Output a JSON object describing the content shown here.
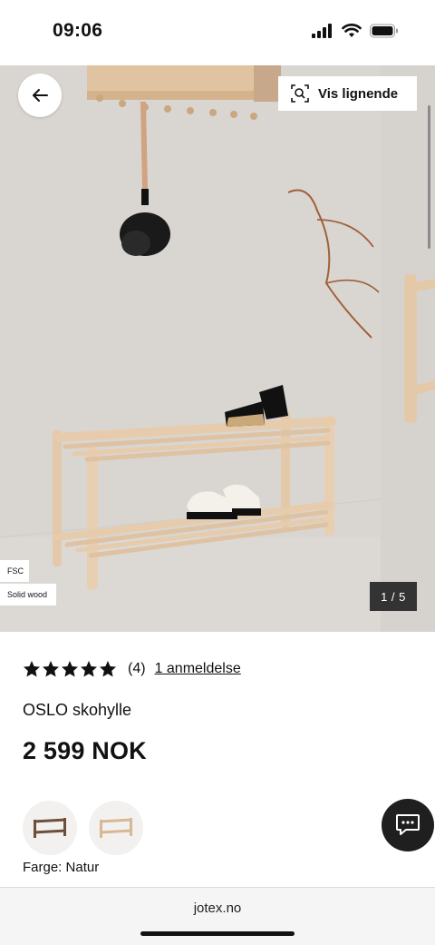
{
  "status_bar": {
    "time": "09:06"
  },
  "gallery": {
    "similar_label": "Vis lignende",
    "badges": [
      "FSC",
      "Solid wood"
    ],
    "counter": "1 / 5"
  },
  "product": {
    "rating": 5,
    "rating_count": "(4)",
    "review_link": "1 anmeldelse",
    "name": "OSLO skohylle",
    "price": "2 599 NOK",
    "color_label": "Farge: Natur",
    "swatches": [
      "walnut-shoe-rack",
      "natural-shoe-rack"
    ]
  },
  "browser": {
    "url": "jotex.no"
  },
  "colors": {
    "accent": "#111111",
    "wall": "#d8d5d1",
    "wood": "#e2c6a6"
  }
}
